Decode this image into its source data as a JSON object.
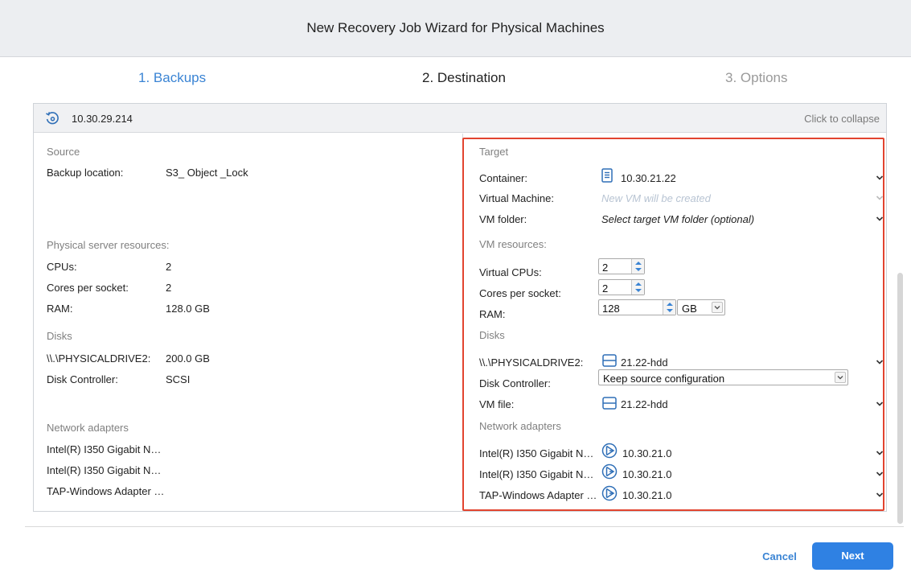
{
  "window": {
    "title": "New Recovery Job Wizard for Physical Machines"
  },
  "steps": [
    {
      "label": "1. Backups",
      "state": "active"
    },
    {
      "label": "2. Destination",
      "state": "current"
    },
    {
      "label": "3. Options",
      "state": "disabled"
    }
  ],
  "panel": {
    "host": "10.30.29.214",
    "collapse_label": "Click to collapse"
  },
  "source": {
    "heading": "Source",
    "backup_location_label": "Backup location:",
    "backup_location_value": "S3_ Object _Lock",
    "resources_heading": "Physical server resources:",
    "cpus_label": "CPUs:",
    "cpus_value": "2",
    "cores_label": "Cores per socket:",
    "cores_value": "2",
    "ram_label": "RAM:",
    "ram_value": "128.0 GB",
    "disks_heading": "Disks",
    "drive_label": "\\\\.\\PHYSICALDRIVE2:",
    "drive_value": "200.0 GB",
    "controller_label": "Disk Controller:",
    "controller_value": "SCSI",
    "network_heading": "Network adapters",
    "adapters": [
      "Intel(R) I350 Gigabit N…",
      "Intel(R) I350 Gigabit N…",
      "TAP-Windows Adapter …"
    ]
  },
  "target": {
    "heading": "Target",
    "container_label": "Container:",
    "container_value": "10.30.21.22",
    "vm_label": "Virtual Machine:",
    "vm_placeholder": "New VM will be created",
    "folder_label": "VM folder:",
    "folder_value": "Select target VM folder (optional)",
    "resources_heading": "VM resources:",
    "vcpus_label": "Virtual CPUs:",
    "vcpus_value": "2",
    "cores_label": "Cores per socket:",
    "cores_value": "2",
    "ram_label": "RAM:",
    "ram_value": "128",
    "ram_unit": "GB",
    "disks_heading": "Disks",
    "drive_label": "\\\\.\\PHYSICALDRIVE2:",
    "drive_value": "21.22-hdd",
    "controller_label": "Disk Controller:",
    "controller_value": "Keep source configuration",
    "vmfile_label": "VM file:",
    "vmfile_value": "21.22-hdd",
    "network_heading": "Network adapters",
    "adapters": [
      {
        "label": "Intel(R) I350 Gigabit N…",
        "network": "10.30.21.0"
      },
      {
        "label": "Intel(R) I350 Gigabit N…",
        "network": "10.30.21.0"
      },
      {
        "label": "TAP-Windows Adapter …",
        "network": "10.30.21.0"
      }
    ]
  },
  "footer": {
    "cancel_label": "Cancel",
    "next_label": "Next"
  },
  "colors": {
    "accent": "#3a84d4",
    "primary_button": "#2f81e3",
    "highlight": "#e2442f"
  }
}
